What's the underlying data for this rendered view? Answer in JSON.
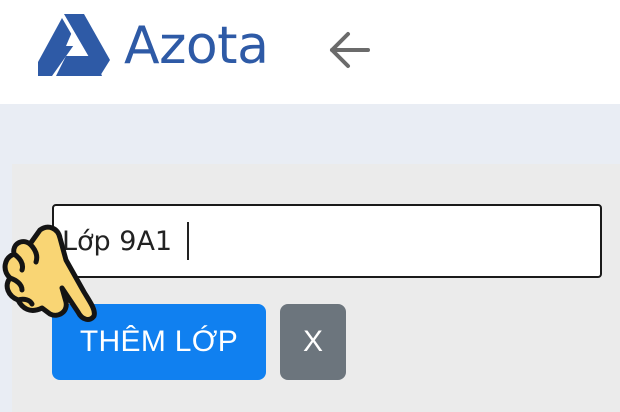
{
  "header": {
    "logo_text": "Azota",
    "logo_icon": "azota-logo-icon",
    "back_icon": "arrow-left-icon"
  },
  "form": {
    "class_name_value": "Lớp 9A1",
    "add_button_label": "THÊM LỚP",
    "close_button_label": "X"
  },
  "overlay": {
    "pointer_icon": "pointing-hand-icon"
  },
  "colors": {
    "brand": "#2e5aa6",
    "primary_button": "#1080f0",
    "secondary_button": "#6c757d",
    "page_bg": "#e9edf4",
    "panel_bg": "#ebebeb"
  }
}
